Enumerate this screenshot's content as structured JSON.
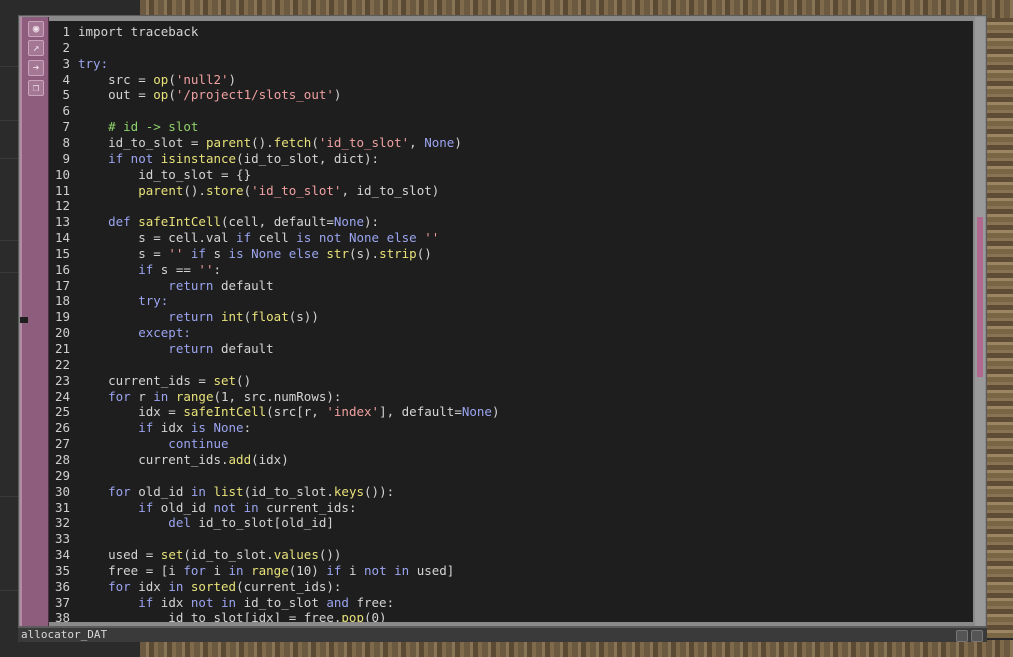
{
  "node": {
    "name": "allocator_DAT",
    "side_icons": [
      "viewer-active-icon",
      "bypass-icon",
      "export-arrow-icon",
      "clone-icon"
    ]
  },
  "code": {
    "lines": [
      [
        {
          "t": "import traceback",
          "c": ""
        }
      ],
      [],
      [
        {
          "t": "try:",
          "c": "kw"
        }
      ],
      [
        {
          "t": "    src = ",
          "c": ""
        },
        {
          "t": "op",
          "c": "fn"
        },
        {
          "t": "(",
          "c": ""
        },
        {
          "t": "'null2'",
          "c": "str"
        },
        {
          "t": ")",
          "c": ""
        }
      ],
      [
        {
          "t": "    out = ",
          "c": ""
        },
        {
          "t": "op",
          "c": "fn"
        },
        {
          "t": "(",
          "c": ""
        },
        {
          "t": "'/project1/slots_out'",
          "c": "str"
        },
        {
          "t": ")",
          "c": ""
        }
      ],
      [],
      [
        {
          "t": "    # id -> slot",
          "c": "cm"
        }
      ],
      [
        {
          "t": "    id_to_slot = ",
          "c": ""
        },
        {
          "t": "parent",
          "c": "fn"
        },
        {
          "t": "().",
          "c": ""
        },
        {
          "t": "fetch",
          "c": "fn"
        },
        {
          "t": "(",
          "c": ""
        },
        {
          "t": "'id_to_slot'",
          "c": "str"
        },
        {
          "t": ", ",
          "c": ""
        },
        {
          "t": "None",
          "c": "cn"
        },
        {
          "t": ")",
          "c": ""
        }
      ],
      [
        {
          "t": "    if not ",
          "c": "kw"
        },
        {
          "t": "isinstance",
          "c": "fn"
        },
        {
          "t": "(id_to_slot, dict):",
          "c": ""
        }
      ],
      [
        {
          "t": "        id_to_slot = {}",
          "c": ""
        }
      ],
      [
        {
          "t": "        ",
          "c": ""
        },
        {
          "t": "parent",
          "c": "fn"
        },
        {
          "t": "().",
          "c": ""
        },
        {
          "t": "store",
          "c": "fn"
        },
        {
          "t": "(",
          "c": ""
        },
        {
          "t": "'id_to_slot'",
          "c": "str"
        },
        {
          "t": ", id_to_slot)",
          "c": ""
        }
      ],
      [],
      [
        {
          "t": "    def ",
          "c": "kw"
        },
        {
          "t": "safeIntCell",
          "c": "fn"
        },
        {
          "t": "(cell, default=",
          "c": ""
        },
        {
          "t": "None",
          "c": "cn"
        },
        {
          "t": "):",
          "c": ""
        }
      ],
      [
        {
          "t": "        s = cell.val ",
          "c": ""
        },
        {
          "t": "if",
          "c": "kw"
        },
        {
          "t": " cell ",
          "c": ""
        },
        {
          "t": "is not None else",
          "c": "kw"
        },
        {
          "t": " ",
          "c": ""
        },
        {
          "t": "''",
          "c": "str"
        }
      ],
      [
        {
          "t": "        s = ",
          "c": ""
        },
        {
          "t": "''",
          "c": "str"
        },
        {
          "t": " ",
          "c": ""
        },
        {
          "t": "if",
          "c": "kw"
        },
        {
          "t": " s ",
          "c": ""
        },
        {
          "t": "is None else",
          "c": "kw"
        },
        {
          "t": " ",
          "c": ""
        },
        {
          "t": "str",
          "c": "fn"
        },
        {
          "t": "(s).",
          "c": ""
        },
        {
          "t": "strip",
          "c": "fn"
        },
        {
          "t": "()",
          "c": ""
        }
      ],
      [
        {
          "t": "        if",
          "c": "kw"
        },
        {
          "t": " s == ",
          "c": ""
        },
        {
          "t": "''",
          "c": "str"
        },
        {
          "t": ":",
          "c": ""
        }
      ],
      [
        {
          "t": "            return",
          "c": "kw"
        },
        {
          "t": " default",
          "c": ""
        }
      ],
      [
        {
          "t": "        try:",
          "c": "kw"
        }
      ],
      [
        {
          "t": "            return ",
          "c": "kw"
        },
        {
          "t": "int",
          "c": "fn"
        },
        {
          "t": "(",
          "c": ""
        },
        {
          "t": "float",
          "c": "fn"
        },
        {
          "t": "(s))",
          "c": ""
        }
      ],
      [
        {
          "t": "        except:",
          "c": "kw"
        }
      ],
      [
        {
          "t": "            return",
          "c": "kw"
        },
        {
          "t": " default",
          "c": ""
        }
      ],
      [],
      [
        {
          "t": "    current_ids = ",
          "c": ""
        },
        {
          "t": "set",
          "c": "fn"
        },
        {
          "t": "()",
          "c": ""
        }
      ],
      [
        {
          "t": "    for",
          "c": "kw"
        },
        {
          "t": " r ",
          "c": ""
        },
        {
          "t": "in ",
          "c": "kw"
        },
        {
          "t": "range",
          "c": "fn"
        },
        {
          "t": "(1, src.numRows):",
          "c": ""
        }
      ],
      [
        {
          "t": "        idx = ",
          "c": ""
        },
        {
          "t": "safeIntCell",
          "c": "fn"
        },
        {
          "t": "(src[r, ",
          "c": ""
        },
        {
          "t": "'index'",
          "c": "str"
        },
        {
          "t": "], default=",
          "c": ""
        },
        {
          "t": "None",
          "c": "cn"
        },
        {
          "t": ")",
          "c": ""
        }
      ],
      [
        {
          "t": "        if",
          "c": "kw"
        },
        {
          "t": " idx ",
          "c": ""
        },
        {
          "t": "is None",
          "c": "kw"
        },
        {
          "t": ":",
          "c": ""
        }
      ],
      [
        {
          "t": "            continue",
          "c": "kw"
        }
      ],
      [
        {
          "t": "        current_ids.",
          "c": ""
        },
        {
          "t": "add",
          "c": "fn"
        },
        {
          "t": "(idx)",
          "c": ""
        }
      ],
      [],
      [
        {
          "t": "    for",
          "c": "kw"
        },
        {
          "t": " old_id ",
          "c": ""
        },
        {
          "t": "in ",
          "c": "kw"
        },
        {
          "t": "list",
          "c": "fn"
        },
        {
          "t": "(id_to_slot.",
          "c": ""
        },
        {
          "t": "keys",
          "c": "fn"
        },
        {
          "t": "()):",
          "c": ""
        }
      ],
      [
        {
          "t": "        if",
          "c": "kw"
        },
        {
          "t": " old_id ",
          "c": ""
        },
        {
          "t": "not in",
          "c": "kw"
        },
        {
          "t": " current_ids:",
          "c": ""
        }
      ],
      [
        {
          "t": "            del",
          "c": "kw"
        },
        {
          "t": " id_to_slot[old_id]",
          "c": ""
        }
      ],
      [],
      [
        {
          "t": "    used = ",
          "c": ""
        },
        {
          "t": "set",
          "c": "fn"
        },
        {
          "t": "(id_to_slot.",
          "c": ""
        },
        {
          "t": "values",
          "c": "fn"
        },
        {
          "t": "())",
          "c": ""
        }
      ],
      [
        {
          "t": "    free = [i ",
          "c": ""
        },
        {
          "t": "for",
          "c": "kw"
        },
        {
          "t": " i ",
          "c": ""
        },
        {
          "t": "in ",
          "c": "kw"
        },
        {
          "t": "range",
          "c": "fn"
        },
        {
          "t": "(10) ",
          "c": ""
        },
        {
          "t": "if",
          "c": "kw"
        },
        {
          "t": " i ",
          "c": ""
        },
        {
          "t": "not in",
          "c": "kw"
        },
        {
          "t": " used]",
          "c": ""
        }
      ],
      [
        {
          "t": "    for",
          "c": "kw"
        },
        {
          "t": " idx ",
          "c": ""
        },
        {
          "t": "in ",
          "c": "kw"
        },
        {
          "t": "sorted",
          "c": "fn"
        },
        {
          "t": "(current_ids):",
          "c": ""
        }
      ],
      [
        {
          "t": "        if",
          "c": "kw"
        },
        {
          "t": " idx ",
          "c": ""
        },
        {
          "t": "not in",
          "c": "kw"
        },
        {
          "t": " id_to_slot ",
          "c": ""
        },
        {
          "t": "and",
          "c": "kw"
        },
        {
          "t": " free:",
          "c": ""
        }
      ],
      [
        {
          "t": "            id_to_slot[idx] = free.",
          "c": ""
        },
        {
          "t": "pop",
          "c": "fn"
        },
        {
          "t": "(0)",
          "c": ""
        }
      ]
    ]
  }
}
